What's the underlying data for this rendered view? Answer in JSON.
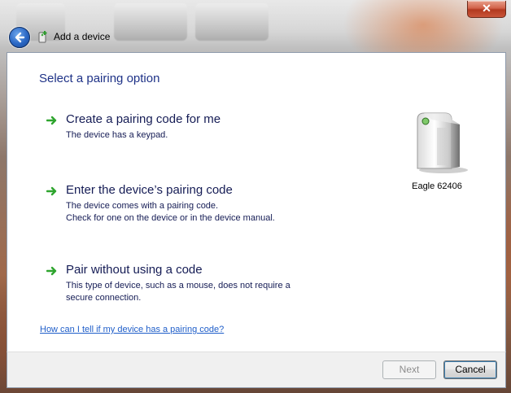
{
  "window": {
    "title": "Add a device",
    "close_label": "✕"
  },
  "main": {
    "heading": "Select a pairing option",
    "options": [
      {
        "title": "Create a pairing code for me",
        "desc_lines": [
          "The device has a keypad."
        ]
      },
      {
        "title": "Enter the device’s pairing code",
        "desc_lines": [
          "The device comes with a pairing code.",
          "Check for one on the device or in the device manual."
        ]
      },
      {
        "title": "Pair without using a code",
        "desc_lines": [
          "This type of device, such as a mouse, does not require a",
          "secure connection."
        ]
      }
    ],
    "device": {
      "name": "Eagle 62406",
      "icon": "device-tower-icon"
    },
    "help_link": "How can I tell if my device has a pairing code?"
  },
  "footer": {
    "next_label": "Next",
    "next_enabled": false,
    "cancel_label": "Cancel"
  },
  "colors": {
    "heading": "#1e3287",
    "option_text": "#151c55",
    "link": "#1f5ec9",
    "arrow_green": "#2fa52f"
  }
}
